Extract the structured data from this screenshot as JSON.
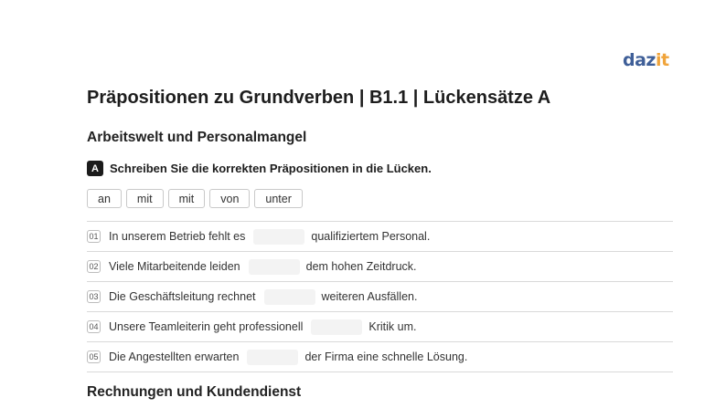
{
  "logo": {
    "part1": "daz",
    "part2": "it"
  },
  "title": "Präpositionen zu Grundverben | B1.1 | Lückensätze A",
  "sections": [
    {
      "heading": "Arbeitswelt und Personalmangel"
    },
    {
      "heading": "Rechnungen und Kundendienst"
    }
  ],
  "task": {
    "badge": "A",
    "instruction": "Schreiben Sie die korrekten Präpositionen in die Lücken."
  },
  "wordbank": [
    "an",
    "mit",
    "mit",
    "von",
    "unter"
  ],
  "rows": [
    {
      "num": "01",
      "before": "In unserem Betrieb fehlt es",
      "after": "qualifiziertem Personal."
    },
    {
      "num": "02",
      "before": "Viele Mitarbeitende leiden",
      "after": "dem hohen Zeitdruck."
    },
    {
      "num": "03",
      "before": "Die Geschäftsleitung rechnet",
      "after": "weiteren Ausfällen."
    },
    {
      "num": "04",
      "before": "Unsere Teamleiterin geht professionell",
      "after": "Kritik um."
    },
    {
      "num": "05",
      "before": "Die Angestellten erwarten",
      "after": "der Firma eine schnelle Lösung."
    }
  ],
  "colors": {
    "brand_blue": "#3f5f98",
    "brand_orange": "#f0a43b",
    "gap_fill": "#f3f3f3"
  }
}
